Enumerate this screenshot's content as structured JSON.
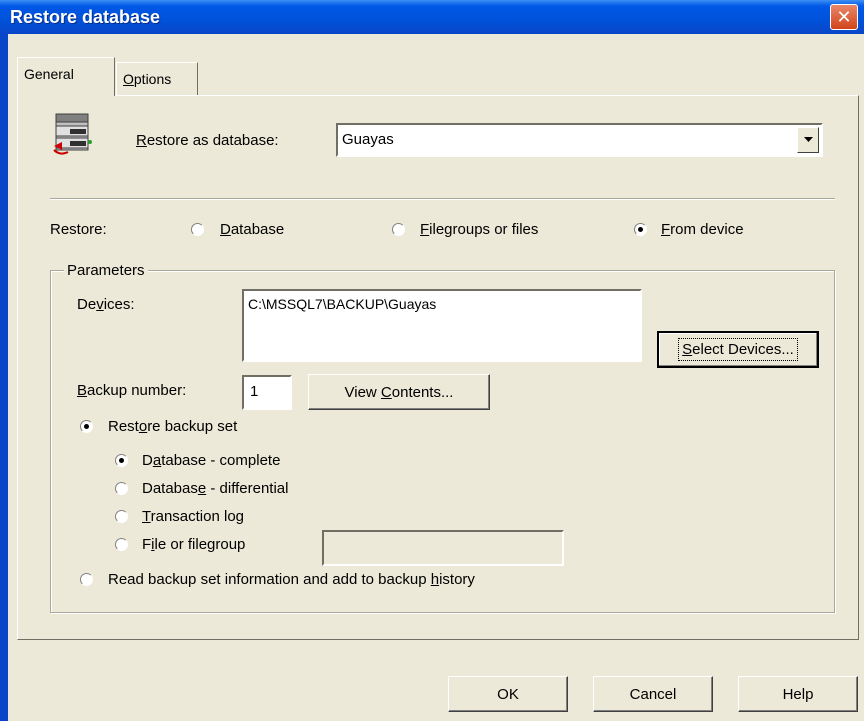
{
  "window": {
    "title": "Restore database"
  },
  "tabs": [
    {
      "label_pre": "General",
      "label_u": "",
      "label_post": ""
    },
    {
      "label_pre": "",
      "label_u": "O",
      "label_post": "ptions"
    }
  ],
  "restore_as": {
    "label_pre": "",
    "label_u": "R",
    "label_post": "estore as database:",
    "value": "Guayas"
  },
  "restore": {
    "label": "Restore:",
    "options": [
      {
        "pre": "",
        "u": "D",
        "post": "atabase",
        "selected": false
      },
      {
        "pre": "",
        "u": "F",
        "post": "ilegroups or files",
        "selected": false
      },
      {
        "pre": "",
        "u": "F",
        "post": "rom device",
        "selected": true
      }
    ]
  },
  "parameters": {
    "title": "Parameters",
    "devices_label": {
      "pre": "De",
      "u": "v",
      "post": "ices:"
    },
    "devices": [
      "C:\\MSSQL7\\BACKUP\\Guayas"
    ],
    "select_devices": {
      "pre": "",
      "u": "S",
      "post": "elect Devices..."
    },
    "backup_number_label": {
      "pre": "",
      "u": "B",
      "post": "ackup number:"
    },
    "backup_number": "1",
    "view_contents": {
      "pre": "View ",
      "u": "C",
      "post": "ontents..."
    },
    "restore_backup_set": {
      "pre": "Rest",
      "u": "o",
      "post": "re backup set",
      "selected": true
    },
    "set_options": [
      {
        "pre": "D",
        "u": "a",
        "post": "tabase - complete",
        "selected": true
      },
      {
        "pre": "Databas",
        "u": "e",
        "post": " - differential",
        "selected": false
      },
      {
        "pre": "",
        "u": "T",
        "post": "ransaction log",
        "selected": false
      },
      {
        "pre": "F",
        "u": "i",
        "post": "le or filegroup",
        "selected": false
      }
    ],
    "file_or_filegroup_value": "",
    "read_backup": {
      "pre": "Read backup set information and add to backup ",
      "u": "h",
      "post": "istory",
      "selected": false
    }
  },
  "buttons": {
    "ok": "OK",
    "cancel": "Cancel",
    "help": "Help"
  }
}
